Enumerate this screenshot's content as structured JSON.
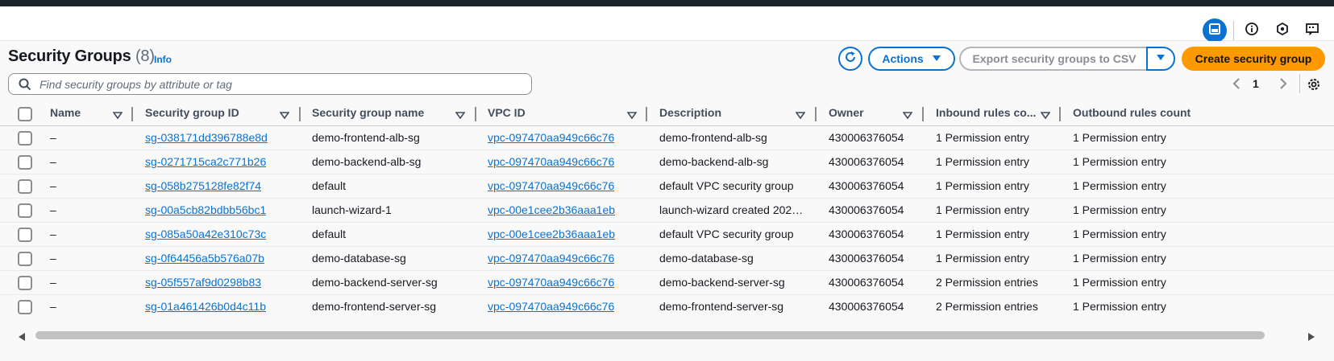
{
  "header": {
    "title": "Security Groups",
    "count": "(8)",
    "info_label": "Info"
  },
  "toolbar": {
    "actions_label": "Actions",
    "export_label": "Export security groups to CSV",
    "create_label": "Create security group"
  },
  "search": {
    "placeholder": "Find security groups by attribute or tag"
  },
  "pagination": {
    "current_page": "1"
  },
  "table": {
    "columns": [
      "Name",
      "Security group ID",
      "Security group name",
      "VPC ID",
      "Description",
      "Owner",
      "Inbound rules co...",
      "Outbound rules count"
    ],
    "rows": [
      {
        "name": "–",
        "sg_id": "sg-038171dd396788e8d",
        "sg_name": "demo-frontend-alb-sg",
        "vpc_id": "vpc-097470aa949c66c76",
        "description": "demo-frontend-alb-sg",
        "owner": "430006376054",
        "inbound": "1 Permission entry",
        "outbound": "1 Permission entry"
      },
      {
        "name": "–",
        "sg_id": "sg-0271715ca2c771b26",
        "sg_name": "demo-backend-alb-sg",
        "vpc_id": "vpc-097470aa949c66c76",
        "description": "demo-backend-alb-sg",
        "owner": "430006376054",
        "inbound": "1 Permission entry",
        "outbound": "1 Permission entry"
      },
      {
        "name": "–",
        "sg_id": "sg-058b275128fe82f74",
        "sg_name": "default",
        "vpc_id": "vpc-097470aa949c66c76",
        "description": "default VPC security group",
        "owner": "430006376054",
        "inbound": "1 Permission entry",
        "outbound": "1 Permission entry"
      },
      {
        "name": "–",
        "sg_id": "sg-00a5cb82bdbb56bc1",
        "sg_name": "launch-wizard-1",
        "vpc_id": "vpc-00e1cee2b36aaa1eb",
        "description": "launch-wizard created 202…",
        "owner": "430006376054",
        "inbound": "1 Permission entry",
        "outbound": "1 Permission entry"
      },
      {
        "name": "–",
        "sg_id": "sg-085a50a42e310c73c",
        "sg_name": "default",
        "vpc_id": "vpc-00e1cee2b36aaa1eb",
        "description": "default VPC security group",
        "owner": "430006376054",
        "inbound": "1 Permission entry",
        "outbound": "1 Permission entry"
      },
      {
        "name": "–",
        "sg_id": "sg-0f64456a5b576a07b",
        "sg_name": "demo-database-sg",
        "vpc_id": "vpc-097470aa949c66c76",
        "description": "demo-database-sg",
        "owner": "430006376054",
        "inbound": "1 Permission entry",
        "outbound": "1 Permission entry"
      },
      {
        "name": "–",
        "sg_id": "sg-05f557af9d0298b83",
        "sg_name": "demo-backend-server-sg",
        "vpc_id": "vpc-097470aa949c66c76",
        "description": "demo-backend-server-sg",
        "owner": "430006376054",
        "inbound": "2 Permission entries",
        "outbound": "1 Permission entry"
      },
      {
        "name": "–",
        "sg_id": "sg-01a461426b0d4c11b",
        "sg_name": "demo-frontend-server-sg",
        "vpc_id": "vpc-097470aa949c66c76",
        "description": "demo-frontend-server-sg",
        "owner": "430006376054",
        "inbound": "2 Permission entries",
        "outbound": "1 Permission entry"
      }
    ]
  },
  "colors": {
    "accent": "#0972d3",
    "primary_button": "#ff9900",
    "top_bar": "#1b232d"
  },
  "icons": [
    "panel-icon",
    "info-icon",
    "feedback-icon",
    "shortcuts-icon",
    "refresh-icon",
    "caret-down-icon",
    "search-icon",
    "chevron-left-icon",
    "chevron-right-icon",
    "settings-icon",
    "sort-icon",
    "scroll-left-icon",
    "scroll-right-icon"
  ]
}
